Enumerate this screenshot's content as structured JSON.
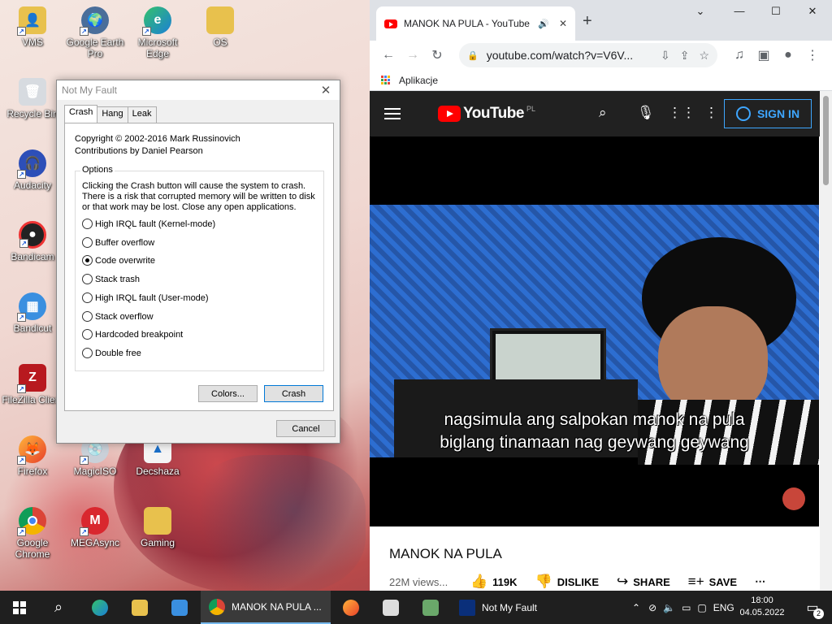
{
  "desktop": {
    "icons": [
      {
        "label": "VMS"
      },
      {
        "label": "Google Earth Pro"
      },
      {
        "label": "Microsoft Edge"
      },
      {
        "label": "OS"
      },
      {
        "label": "Recycle Bin"
      },
      {
        "label": "Audacity"
      },
      {
        "label": "Bandicam"
      },
      {
        "label": "Bandicut"
      },
      {
        "label": "FileZilla Client"
      },
      {
        "label": "Firefox"
      },
      {
        "label": "MagicISO"
      },
      {
        "label": "Decshaza"
      },
      {
        "label": "Google Chrome"
      },
      {
        "label": "MEGAsync"
      },
      {
        "label": "Gaming"
      }
    ]
  },
  "dialog": {
    "title": "Not My Fault",
    "tabs": [
      "Crash",
      "Hang",
      "Leak"
    ],
    "copyright": "Copyright © 2002-2016 Mark Russinovich",
    "contrib": "Contributions by Daniel Pearson",
    "options_label": "Options",
    "desc": "Clicking the Crash button will cause the system to crash. There is a risk that corrupted memory will be written to disk or that work may be lost. Close any open applications.",
    "options": [
      {
        "label": "High IRQL fault (Kernel-mode)"
      },
      {
        "label": "Buffer overflow"
      },
      {
        "label": "Code overwrite"
      },
      {
        "label": "Stack trash"
      },
      {
        "label": "High IRQL fault (User-mode)"
      },
      {
        "label": "Stack overflow"
      },
      {
        "label": "Hardcoded breakpoint"
      },
      {
        "label": "Double free"
      }
    ],
    "selected_option": "Code overwrite",
    "colors_label": "Colors...",
    "crash_label": "Crash",
    "cancel_label": "Cancel"
  },
  "browser": {
    "tab_title": "MANOK NA PULA - YouTube",
    "url": "youtube.com/watch?v=V6V...",
    "bookmark": "Aplikacje",
    "accent": "#ff0000"
  },
  "youtube": {
    "brand": "YouTube",
    "region": "PL",
    "sign_in": "SIGN IN",
    "subtitle_1": "nagsimula ang salpokan manok na pula",
    "subtitle_2": "biglang tinamaan nag geywang geywang",
    "video_title": "MANOK NA PULA",
    "views": "22M views...",
    "likes": "119K",
    "dislike": "DISLIKE",
    "share": "SHARE",
    "save": "SAVE"
  },
  "taskbar": {
    "chrome_task": "MANOK NA PULA ...",
    "nmf_task": "Not My Fault",
    "lang": "ENG",
    "time": "18:00",
    "date": "04.05.2022",
    "notif_count": "2"
  }
}
